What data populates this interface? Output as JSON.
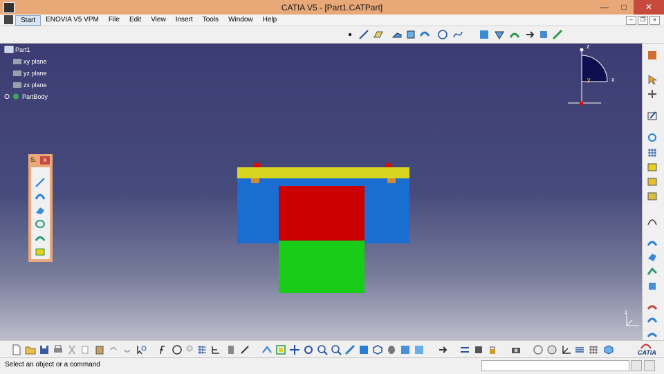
{
  "window": {
    "title": "CATIA V5 - [Part1.CATPart]",
    "minimize": "—",
    "maximize": "□",
    "close": "✕"
  },
  "menu": {
    "items": [
      "Start",
      "ENOVIA V5 VPM",
      "File",
      "Edit",
      "View",
      "Insert",
      "Tools",
      "Window",
      "Help"
    ]
  },
  "mdi": {
    "minimize": "–",
    "restore": "❐",
    "close": "×"
  },
  "tree": {
    "root": "Part1",
    "nodes": [
      {
        "label": "xy plane",
        "icon": "plane-icon"
      },
      {
        "label": "yz plane",
        "icon": "plane-icon"
      },
      {
        "label": "zx plane",
        "icon": "plane-icon"
      },
      {
        "label": "PartBody",
        "icon": "partbody-gear-icon"
      }
    ]
  },
  "compass": {
    "z": "z",
    "x": "x",
    "y": "y"
  },
  "axis_triad": {
    "z": "z"
  },
  "floating_toolbar": {
    "title": "S.",
    "close": "x"
  },
  "status": {
    "message": "Select an object or a command"
  },
  "logo": {
    "text": "CATIA"
  },
  "colors": {
    "title_bar": "#e8a878",
    "viewport_top": "#3c3c72",
    "viewport_bottom": "#bdbdcc",
    "yellow_plate": "#d8d420",
    "blue_body": "#1a6ed0",
    "red_block": "#cc0000",
    "green_block": "#18cc18",
    "orange_tab": "#d28a30"
  }
}
